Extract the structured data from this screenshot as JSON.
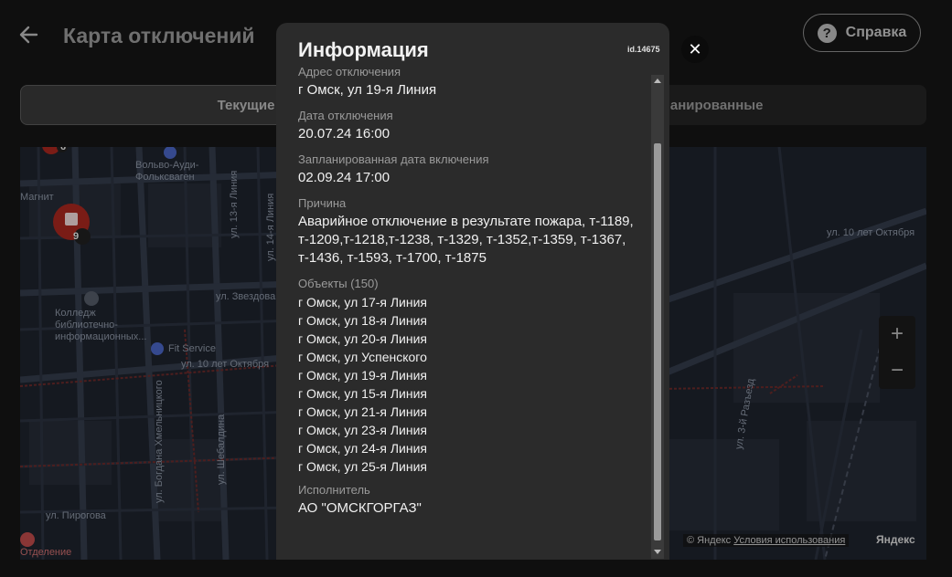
{
  "header": {
    "title": "Карта отключений",
    "help_label": "Справка",
    "help_icon": "?"
  },
  "tabs": [
    {
      "label": "Текущие"
    },
    {
      "label": "Запланированные"
    }
  ],
  "map": {
    "labels": {
      "volvo": "Вольво-Ауди-Фольксваген",
      "magnit": "Магнит",
      "college": "Колледж библиотечно-информационных...",
      "fit_service": "Fit Service",
      "zvezdova": "ул. Звездова",
      "oktyabrya_left": "ул. 10 лет Октября",
      "oktyabrya_right": "ул. 10 лет Октября",
      "pirogova": "ул. Пирогова",
      "otdelenie": "Отделение",
      "razezd": "ул. 3-й Разъезд",
      "khmelnitskogo": "ул. Богдана Хмельницкого",
      "shebaldina": "ул. Шебалдина",
      "liniya13": "ул. 13-я Линия",
      "liniya14": "ул. 14-я Линия",
      "cluster_count": "9",
      "top_count": "6"
    },
    "zoom_in": "+",
    "zoom_out": "−",
    "attribution_prefix": "© Яндекс",
    "attribution_link": "Условия использования",
    "brand": "Яндекс"
  },
  "modal": {
    "title": "Информация",
    "id": "id.14675",
    "close": "✕",
    "address_label": "Адрес отключения",
    "address_value": "г Омск, ул 19-я Линия",
    "date_label": "Дата отключения",
    "date_value": "20.07.24 16:00",
    "planned_label": "Запланированная дата включения",
    "planned_value": "02.09.24 17:00",
    "reason_label": "Причина",
    "reason_value": "Аварийное отключение в результате пожара, т-1189, т-1209,т-1218,т-1238, т-1329, т-1352,т-1359, т-1367, т-1436, т-1593, т-1700, т-1875",
    "objects_label": "Объекты (150)",
    "objects": [
      "г Омск, ул 17-я Линия",
      "г Омск, ул 18-я Линия",
      "г Омск, ул 20-я Линия",
      "г Омск, ул Успенского",
      "г Омск, ул 19-я Линия",
      "г Омск, ул 15-я Линия",
      "г Омск, ул 21-я Линия",
      "г Омск, ул 23-я Линия",
      "г Омск, ул 24-я Линия",
      "г Омск, ул 25-я Линия"
    ],
    "executor_label": "Исполнитель",
    "executor_value": "АО \"ОМСКГОРГАЗ\""
  }
}
